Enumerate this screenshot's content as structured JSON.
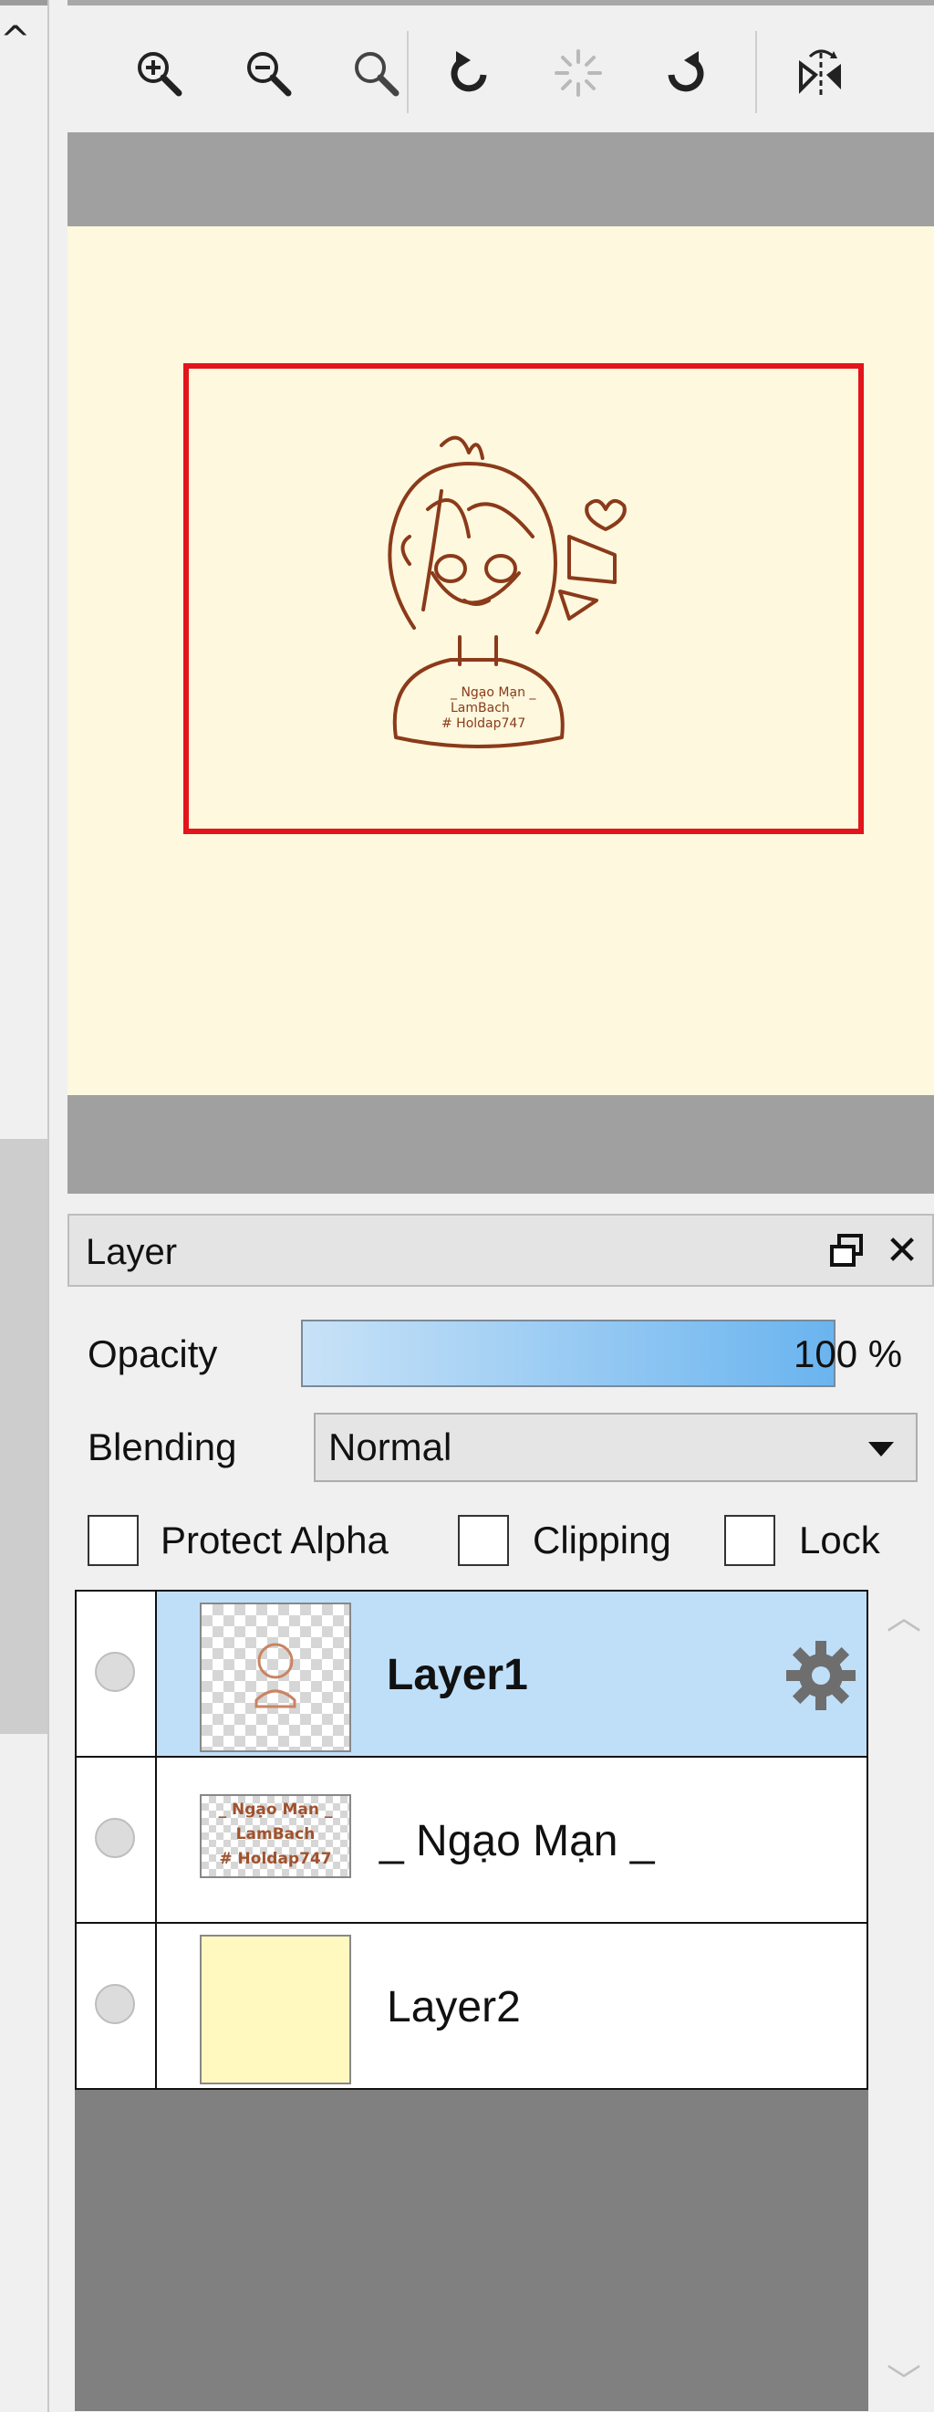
{
  "navigator": {
    "toolbar": [
      {
        "name": "zoom-in-button",
        "icon": "zoom-in-icon",
        "enabled": true
      },
      {
        "name": "zoom-out-button",
        "icon": "zoom-out-icon",
        "enabled": true
      },
      {
        "name": "zoom-fit-button",
        "icon": "magnifier-icon",
        "enabled": true
      },
      {
        "name": "rotate-left-button",
        "icon": "rotate-left-icon",
        "enabled": true
      },
      {
        "name": "reset-rotation-button",
        "icon": "spinner-icon",
        "enabled": false
      },
      {
        "name": "rotate-right-button",
        "icon": "rotate-right-icon",
        "enabled": true
      },
      {
        "name": "flip-horizontal-button",
        "icon": "flip-horizontal-icon",
        "enabled": true
      }
    ],
    "canvas_color": "#fdf8de",
    "view_rect_color": "#e3141b"
  },
  "layer_panel": {
    "title": "Layer",
    "opacity_label": "Opacity",
    "opacity_value": "100 %",
    "blending_label": "Blending",
    "blending_value": "Normal",
    "checkboxes": {
      "protect_alpha": {
        "label": "Protect Alpha",
        "checked": false
      },
      "clipping": {
        "label": "Clipping",
        "checked": false
      },
      "lock": {
        "label": "Lock",
        "checked": false
      }
    },
    "layers": [
      {
        "name": "Layer1",
        "selected": true,
        "has_settings": true
      },
      {
        "name": "_ Ngạo Mạn _",
        "selected": false,
        "has_settings": false,
        "thumb_text": [
          "_ Ngạo Mạn _",
          "LamBach",
          "# Holdap747"
        ]
      },
      {
        "name": "Layer2",
        "selected": false,
        "has_settings": false
      }
    ],
    "selected_color": "#bfdff9"
  }
}
